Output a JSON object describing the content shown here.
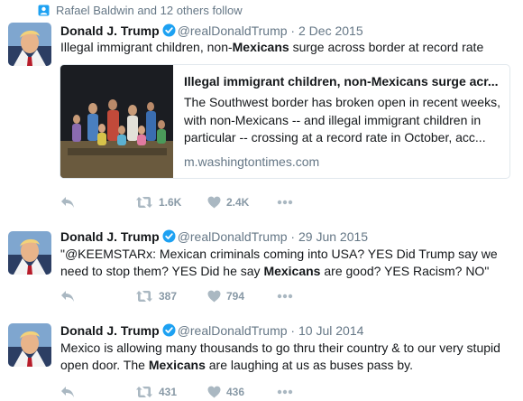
{
  "context": {
    "text": "Rafael Baldwin and 12 others follow"
  },
  "tweets": [
    {
      "name": "Donald J. Trump",
      "handle": "@realDonaldTrump",
      "date": "2 Dec 2015",
      "text_before": "Illegal immigrant children, non-",
      "text_bold": "Mexicans",
      "text_after": " surge across border at record rate",
      "card": {
        "title": "Illegal immigrant children, non-Mexicans surge acr...",
        "description": "The Southwest border has broken open in recent weeks, with non-Mexicans -- and illegal immigrant children in particular -- crossing at a record rate in October, acc...",
        "domain": "m.washingtontimes.com"
      },
      "retweets": "1.6K",
      "likes": "2.4K"
    },
    {
      "name": "Donald J. Trump",
      "handle": "@realDonaldTrump",
      "date": "29 Jun 2015",
      "text_before": "\"@KEEMSTARx: Mexican criminals coming into USA? YES Did Trump say we need to stop them? YES Did he say ",
      "text_bold": "Mexicans",
      "text_after": " are good? YES Racism? NO\"",
      "retweets": "387",
      "likes": "794"
    },
    {
      "name": "Donald J. Trump",
      "handle": "@realDonaldTrump",
      "date": "10 Jul 2014",
      "text_before": "Mexico is allowing many thousands to go thru their country & to our very stupid open door. The ",
      "text_bold": "Mexicans",
      "text_after": " are laughing at us as buses pass by.",
      "retweets": "431",
      "likes": "436"
    }
  ],
  "colors": {
    "verified": "#1da1f2",
    "meta": "#657786",
    "icon": "#aab8c2",
    "border": "#e6ecf0"
  },
  "icons": [
    "person-icon",
    "verified-badge-icon",
    "reply-icon",
    "retweet-icon",
    "heart-icon",
    "more-icon"
  ]
}
